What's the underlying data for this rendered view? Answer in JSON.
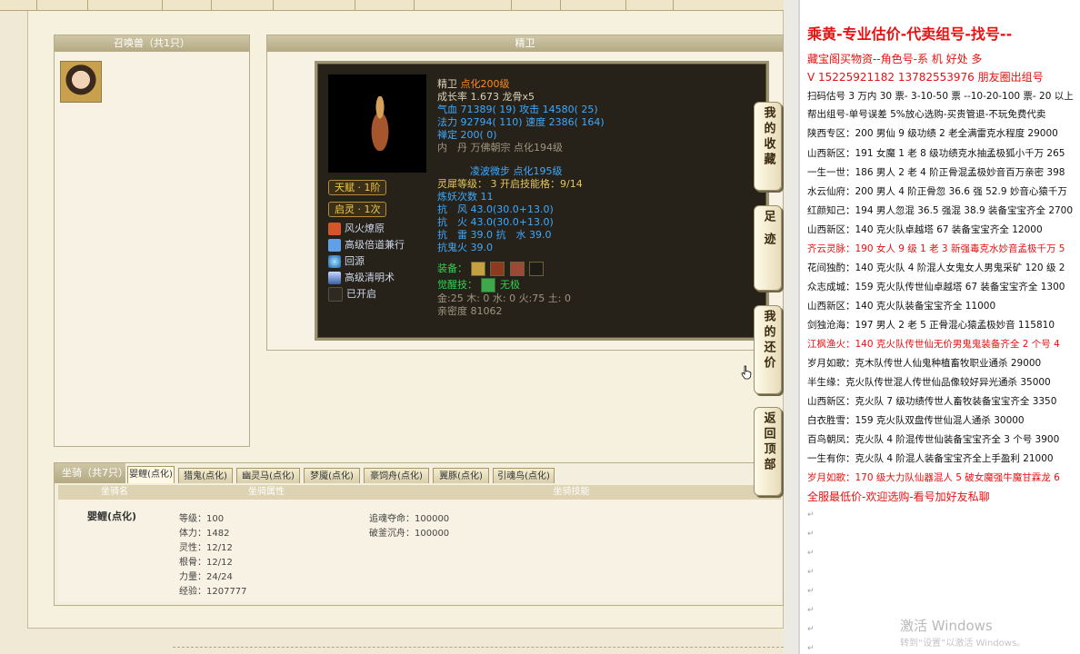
{
  "summon": {
    "header": "召唤兽（共1只）"
  },
  "detail": {
    "header": "精卫",
    "name": "精卫",
    "level": "点化200级",
    "growth_label": "成长率",
    "growth": "1.673",
    "bone": "龙骨x5",
    "hp_label": "气血",
    "hp": "71389( 19)",
    "atk_label": "攻击",
    "atk": "14580( 25)",
    "mp_label": "法力",
    "mp": "92794( 110)",
    "spd_label": "速度",
    "spd": "2386( 164)",
    "zen_label": "禅定",
    "zen": "200( 0)",
    "neidan_label": "内　丹",
    "neidan": "万佛朝宗 点化194级",
    "lingbo": "凌波微步 点化195级",
    "lingxi_label": "灵犀等级：",
    "lingxi": "3 开启技能格：9/14",
    "lianyao": "炼妖次数 11",
    "res_wind_label": "抗　风",
    "res_wind": "43.0(30.0+13.0)",
    "res_fire_label": "抗　火",
    "res_fire": "43.0(30.0+13.0)",
    "res_thunder_label": "抗　雷",
    "res_thunder": "39.0",
    "res_water_label": "抗　水",
    "res_water": "39.0",
    "res_ghostfire": "抗鬼火 39.0",
    "talent": "天赋 · 1阶",
    "qiling": "启灵 · 1次",
    "skills": [
      "风火燎原",
      "高级倍道兼行",
      "回源",
      "高级清明术",
      "已开启"
    ],
    "equip_label": "装备：",
    "awaken_label": "觉醒技：",
    "awaken": "无极",
    "elements": "金:25 木: 0 水: 0 火:75 土: 0",
    "intimacy": "亲密度 81062"
  },
  "mount": {
    "title": "坐骑（共7只）",
    "tabs": [
      "婴鲤(点化)",
      "猎鬼(点化)",
      "幽灵马(点化)",
      "梦魇(点化)",
      "豪饲舟(点化)",
      "翼豚(点化)",
      "引魂鸟(点化)"
    ],
    "col_name": "坐骑名",
    "col_attr": "坐骑属性",
    "col_skill": "坐骑技能",
    "name": "婴鲤(点化)",
    "attrs": [
      "等级：100",
      "体力：1482",
      "灵性：12/12",
      "根骨：12/12",
      "力量：24/24",
      "经验：1207777"
    ],
    "skills": [
      "追魂夺命：100000",
      "破釜沉舟：100000"
    ]
  },
  "side_buttons": [
    "我的收藏",
    "足迹",
    "我的还价",
    "返回顶部"
  ],
  "doc": {
    "lines": [
      {
        "t": "乘黄-专业估价-代卖组号-找号--",
        "c": "red",
        "b": true,
        "s": 16
      },
      {
        "t": "藏宝阁买物资--角色号-系 机 好处 多",
        "c": "red",
        "s": 12
      },
      {
        "t": "V 15225921182   13782553976 朋友圈出组号",
        "c": "red",
        "s": 12
      },
      {
        "t": "扫码估号 3 万内 30 票- 3-10-50 票 --10-20-100 票- 20 以上",
        "c": "",
        "s": 10.5
      },
      {
        "t": "帮出组号-单号误差 5%放心选购-买贵管退-不玩免费代卖",
        "c": "",
        "s": 10.5
      },
      {
        "t": "陕西专区：200 男仙 9 级功绩 2 老全满雷克水程度 29000",
        "c": "",
        "s": 10.5
      },
      {
        "t": "山西新区：191 女魔 1 老 8 级功绩克水抽孟极狐小千万 265",
        "c": "",
        "s": 10.5
      },
      {
        "t": "一生一世：186 男人 2 老 4 阶正骨混孟极妙音百万亲密 398",
        "c": "",
        "s": 10.5
      },
      {
        "t": "水云仙府：200 男人 4 阶正骨忽 36.6 强 52.9 妙音心猿千万",
        "c": "",
        "s": 10.5
      },
      {
        "t": "红颜知己：194 男人忽混 36.5 强混 38.9 装备宝宝齐全 2700",
        "c": "",
        "s": 10.5
      },
      {
        "t": "山西新区：140 克火队卓越塔 67 装备宝宝齐全 12000",
        "c": "",
        "s": 10.5
      },
      {
        "t": "齐云灵脉：190 女人 9 级 1 老 3 新强毒克水妙音孟极千万 5",
        "c": "red",
        "s": 10.5
      },
      {
        "t": "花间独酌：140 克火队 4 阶混人女鬼女人男鬼采矿 120 级 2",
        "c": "",
        "s": 10.5
      },
      {
        "t": "众志成城：159 克火队传世仙卓越塔 67 装备宝宝齐全 1300",
        "c": "",
        "s": 10.5
      },
      {
        "t": "山西新区：140 克火队装备宝宝齐全 11000",
        "c": "",
        "s": 10.5
      },
      {
        "t": "剑独沧海：197 男人 2 老 5 正骨混心猿孟极妙音 115810",
        "c": "",
        "s": 10.5
      },
      {
        "t": "江枫渔火：140 克火队传世仙无价男鬼鬼装备齐全 2 个号 4",
        "c": "red",
        "s": 10.5
      },
      {
        "t": "岁月如歌：克木队传世人仙鬼种植畜牧职业通杀 29000",
        "c": "",
        "s": 10.5
      },
      {
        "t": "半生缘：克火队传世混人传世仙品像较好异光通杀 35000",
        "c": "",
        "s": 10.5
      },
      {
        "t": "山西新区：克火队 7 级功绩传世人畜牧装备宝宝齐全 3350",
        "c": "",
        "s": 10.5
      },
      {
        "t": "白衣胜雪：159 克火队双盘传世仙混人通杀 30000",
        "c": "",
        "s": 10.5
      },
      {
        "t": "百鸟朝凤：克火队 4 阶混传世仙装备宝宝齐全 3 个号 3900",
        "c": "",
        "s": 10.5
      },
      {
        "t": "一生有你：克火队 4 阶混人装备宝宝齐全上手盈利 21000",
        "c": "",
        "s": 10.5
      },
      {
        "t": "岁月如歌：170 级大力队仙器混人 5 破女魔强牛魔甘霖龙 6",
        "c": "red",
        "s": 10.5
      },
      {
        "t": "全服最低价-欢迎选购-看号加好友私聊",
        "c": "red",
        "s": 12
      }
    ],
    "watermark": "激活 Windows",
    "watermark_sub": "转到“设置”以激活 Windows。"
  },
  "colors": {
    "accent_red": "#e81010",
    "card_bg": "#26221a",
    "panel_head": "#b3a983"
  },
  "icons": {
    "cursor": "hand-pointer-icon"
  }
}
